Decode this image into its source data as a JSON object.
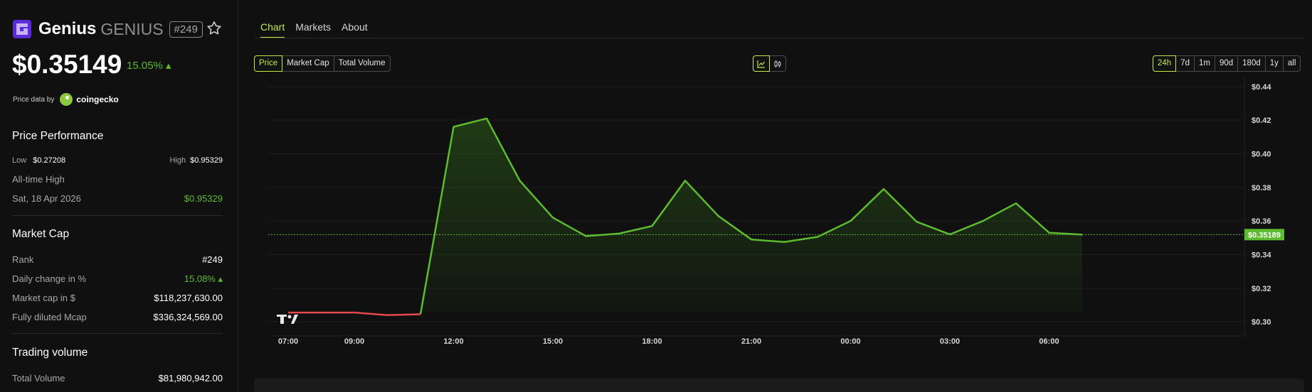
{
  "coin": {
    "name": "Genius",
    "symbol": "GENIUS",
    "rank_badge": "#249",
    "price": "$0.35149",
    "change": "15.05% ▴"
  },
  "price_data": {
    "label": "Price data by",
    "provider": "coingecko"
  },
  "performance": {
    "title": "Price Performance",
    "low_label": "Low",
    "low_value": "$0.27208",
    "high_label": "High",
    "high_value": "$0.95329",
    "ath_label": "All-time High",
    "ath_date": "Sat, 18 Apr 2026",
    "ath_value": "$0.95329"
  },
  "market_cap": {
    "title": "Market Cap",
    "rows": [
      {
        "label": "Rank",
        "value": "#249"
      },
      {
        "label": "Daily change in %",
        "value": "15.08% ▴"
      },
      {
        "label": "Market cap in $",
        "value": "$118,237,630.00"
      },
      {
        "label": "Fully diluted Mcap",
        "value": "$336,324,569.00"
      }
    ]
  },
  "trading_volume": {
    "title": "Trading volume",
    "rows": [
      {
        "label": "Total Volume",
        "value": "$81,980,942.00"
      }
    ]
  },
  "tabs": [
    "Chart",
    "Markets",
    "About"
  ],
  "metric_buttons": [
    "Price",
    "Market Cap",
    "Total Volume"
  ],
  "chart_type_icons": [
    "line-chart-icon",
    "candlestick-icon"
  ],
  "range_buttons": [
    "24h",
    "7d",
    "1m",
    "90d",
    "180d",
    "1y",
    "all"
  ],
  "colors": {
    "accent": "#c5e84a",
    "up": "#5dbb2f",
    "down": "#e5484d",
    "bg": "#101010"
  },
  "chart_data": {
    "type": "line",
    "x": [
      "07:00",
      "08:00",
      "09:00",
      "10:00",
      "11:00",
      "12:00",
      "13:00",
      "14:00",
      "15:00",
      "16:00",
      "17:00",
      "18:00",
      "19:00",
      "20:00",
      "21:00",
      "22:00",
      "23:00",
      "00:00",
      "01:00",
      "02:00",
      "03:00",
      "04:00",
      "05:00",
      "06:00",
      "07:00"
    ],
    "values": [
      0.3055,
      0.3055,
      0.3055,
      0.304,
      0.3045,
      0.416,
      0.421,
      0.384,
      0.362,
      0.351,
      0.3525,
      0.357,
      0.384,
      0.363,
      0.349,
      0.3475,
      0.3505,
      0.36,
      0.379,
      0.3595,
      0.352,
      0.36,
      0.3705,
      0.353,
      0.3519
    ],
    "xticks": [
      "07:00",
      "09:00",
      "12:00",
      "15:00",
      "18:00",
      "21:00",
      "00:00",
      "03:00",
      "06:00"
    ],
    "yticks": [
      "$0.44",
      "$0.42",
      "$0.40",
      "$0.38",
      "$0.36",
      "$0.34",
      "$0.32",
      "$0.30"
    ],
    "ylim": [
      0.295,
      0.445
    ],
    "current_price_label": "$0.35189",
    "current_price": 0.35189,
    "grid": true
  }
}
